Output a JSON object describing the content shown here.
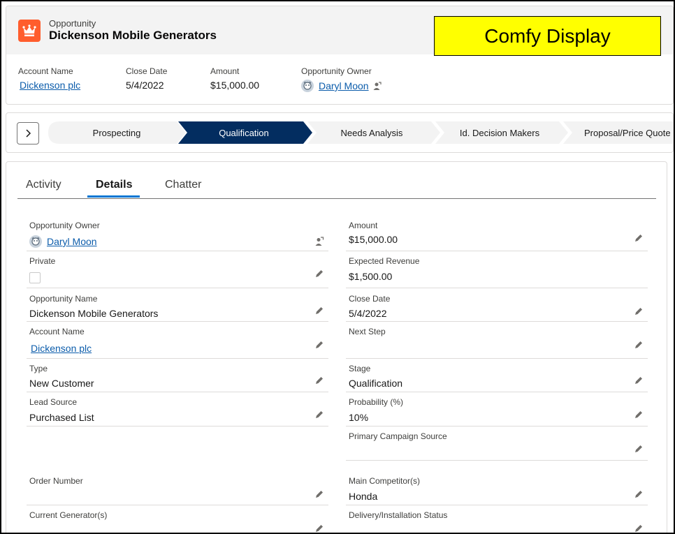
{
  "header": {
    "object_label": "Opportunity",
    "record_title": "Dickenson Mobile Generators",
    "overlay_badge": "Comfy Display",
    "highlights": [
      {
        "label": "Account Name",
        "value": "Dickenson plc"
      },
      {
        "label": "Close Date",
        "value": "5/4/2022"
      },
      {
        "label": "Amount",
        "value": "$15,000.00"
      },
      {
        "label": "Opportunity Owner",
        "value": "Daryl Moon"
      }
    ]
  },
  "path": {
    "steps": [
      {
        "label": "Prospecting"
      },
      {
        "label": "Qualification",
        "current": true
      },
      {
        "label": "Needs Analysis"
      },
      {
        "label": "Id. Decision Makers"
      },
      {
        "label": "Proposal/Price Quote"
      }
    ]
  },
  "tabs": [
    {
      "label": "Activity"
    },
    {
      "label": "Details",
      "active": true
    },
    {
      "label": "Chatter"
    }
  ],
  "fields": {
    "opportunity_owner": {
      "label": "Opportunity Owner",
      "value": "Daryl Moon"
    },
    "amount": {
      "label": "Amount",
      "value": "$15,000.00"
    },
    "private": {
      "label": "Private",
      "checked": false
    },
    "expected_revenue": {
      "label": "Expected Revenue",
      "value": "$1,500.00"
    },
    "opportunity_name": {
      "label": "Opportunity Name",
      "value": "Dickenson Mobile Generators"
    },
    "close_date": {
      "label": "Close Date",
      "value": "5/4/2022"
    },
    "account_name": {
      "label": "Account Name",
      "value": "Dickenson plc"
    },
    "next_step": {
      "label": "Next Step",
      "value": ""
    },
    "type": {
      "label": "Type",
      "value": "New Customer"
    },
    "stage": {
      "label": "Stage",
      "value": "Qualification"
    },
    "lead_source": {
      "label": "Lead Source",
      "value": "Purchased List"
    },
    "probability": {
      "label": "Probability (%)",
      "value": "10%"
    },
    "primary_campaign_source": {
      "label": "Primary Campaign Source",
      "value": ""
    },
    "order_number": {
      "label": "Order Number",
      "value": ""
    },
    "main_competitors": {
      "label": "Main Competitor(s)",
      "value": "Honda"
    },
    "current_generators": {
      "label": "Current Generator(s)",
      "value": ""
    },
    "delivery_status": {
      "label": "Delivery/Installation Status",
      "value": ""
    }
  },
  "colors": {
    "object_icon": "#ff5d2d",
    "path_current": "#032d60",
    "path_incomplete": "#f3f3f3",
    "link": "#0b5cab",
    "tab_active_underline": "#0176d3",
    "badge_background": "#ffff00"
  }
}
